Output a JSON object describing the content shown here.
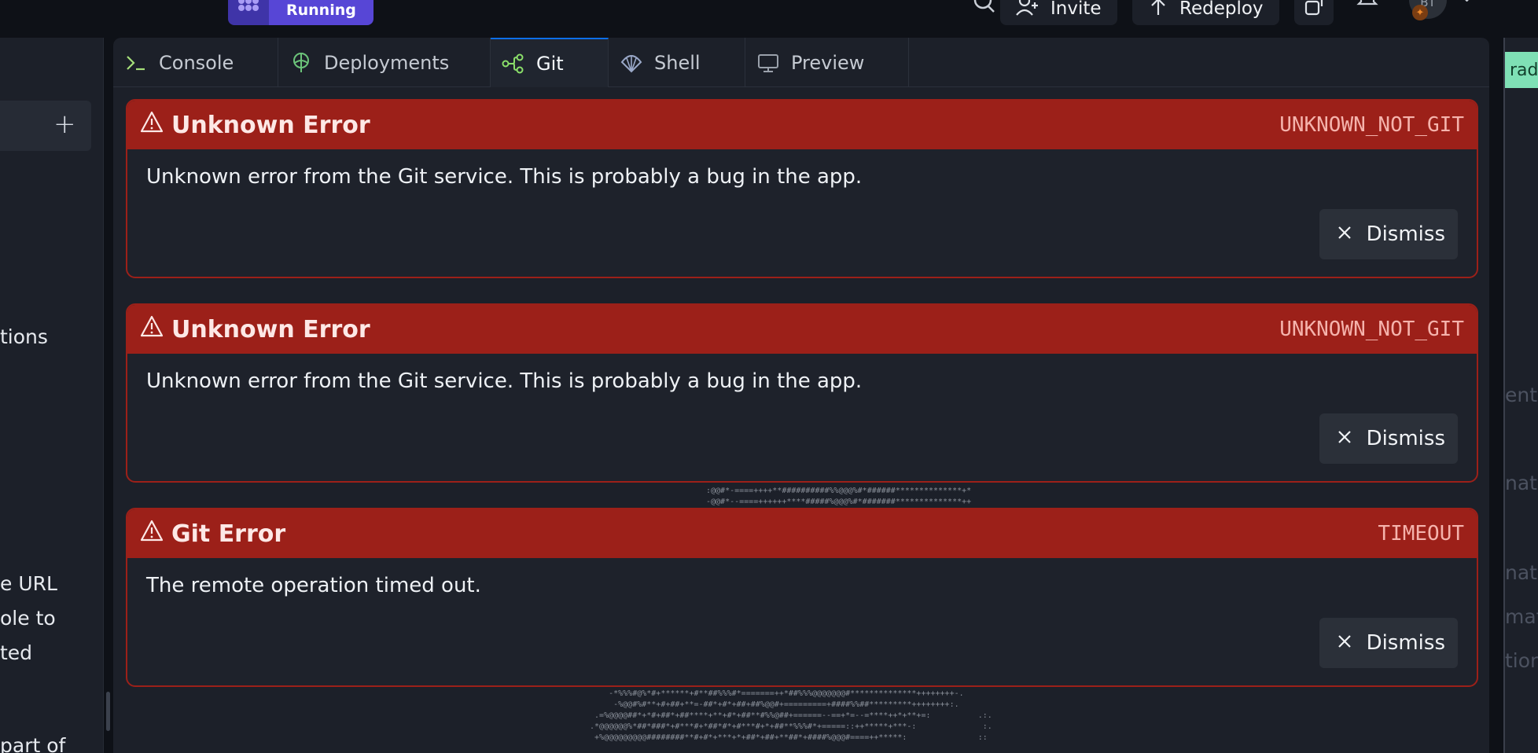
{
  "topbar": {
    "run_status": "Running",
    "invite_label": "Invite",
    "redeploy_label": "Redeploy",
    "avatar_initials": "BT"
  },
  "left_panel": {
    "text_fragments": [
      "tions",
      "e URL",
      "ole to",
      "ted",
      "part of"
    ]
  },
  "tabs": [
    {
      "label": "Console",
      "icon": "terminal-icon"
    },
    {
      "label": "Deployments",
      "icon": "deployments-icon"
    },
    {
      "label": "Git",
      "icon": "git-icon",
      "active": true
    },
    {
      "label": "Shell",
      "icon": "shell-icon"
    },
    {
      "label": "Preview",
      "icon": "monitor-icon"
    }
  ],
  "errors": [
    {
      "title": "Unknown Error",
      "code": "UNKNOWN_NOT_GIT",
      "message": "Unknown error from the Git service. This is probably a bug in the app.",
      "dismiss_label": "Dismiss"
    },
    {
      "title": "Unknown Error",
      "code": "UNKNOWN_NOT_GIT",
      "message": "Unknown error from the Git service. This is probably a bug in the app.",
      "dismiss_label": "Dismiss"
    },
    {
      "title": "Git Error",
      "code": "TIMEOUT",
      "message": "The remote operation timed out.",
      "dismiss_label": "Dismiss"
    }
  ],
  "ascii_art": {
    "top": ":@@#*-====++++**##########%%@@@%#*######**************+*\n-@@#*--====++++++****#####%@@@%#*#######**************++",
    "bottom": "  .:*@@##*+*+#%@%#%#-:..-+=-=+*****#%%@@@@@@@@@@@@@@@#***************++++=+=+=-\n     -*%%%#@%*#+******+#**##%%%#*=======++*##%%%@@@@@@@#**************++++++++-.\n      -%@@#%#**+#+##+**=-##*+#*+##+##%@@#+=========+####%%##*********++++++++:.\n  .=%@@@@##*+*#+##*+##****+**+#*+##**#%%@##+======--==+*=--=****++*+**+=:          .:.\n .*@@@@@@%*##*###*+#***#+*##*#*+#***#+*+##**%%%#*+=====::++*****+***-:              :.\n  +%@@@@@@@@@########**#+#*+***+*+##*+##+**##*+####%@@@#====++*****:               ::"
  },
  "right_panel": {
    "upgrade_label": "rade",
    "text_fragments": [
      "ent",
      "natio",
      "natio",
      "mat",
      "tion"
    ]
  }
}
